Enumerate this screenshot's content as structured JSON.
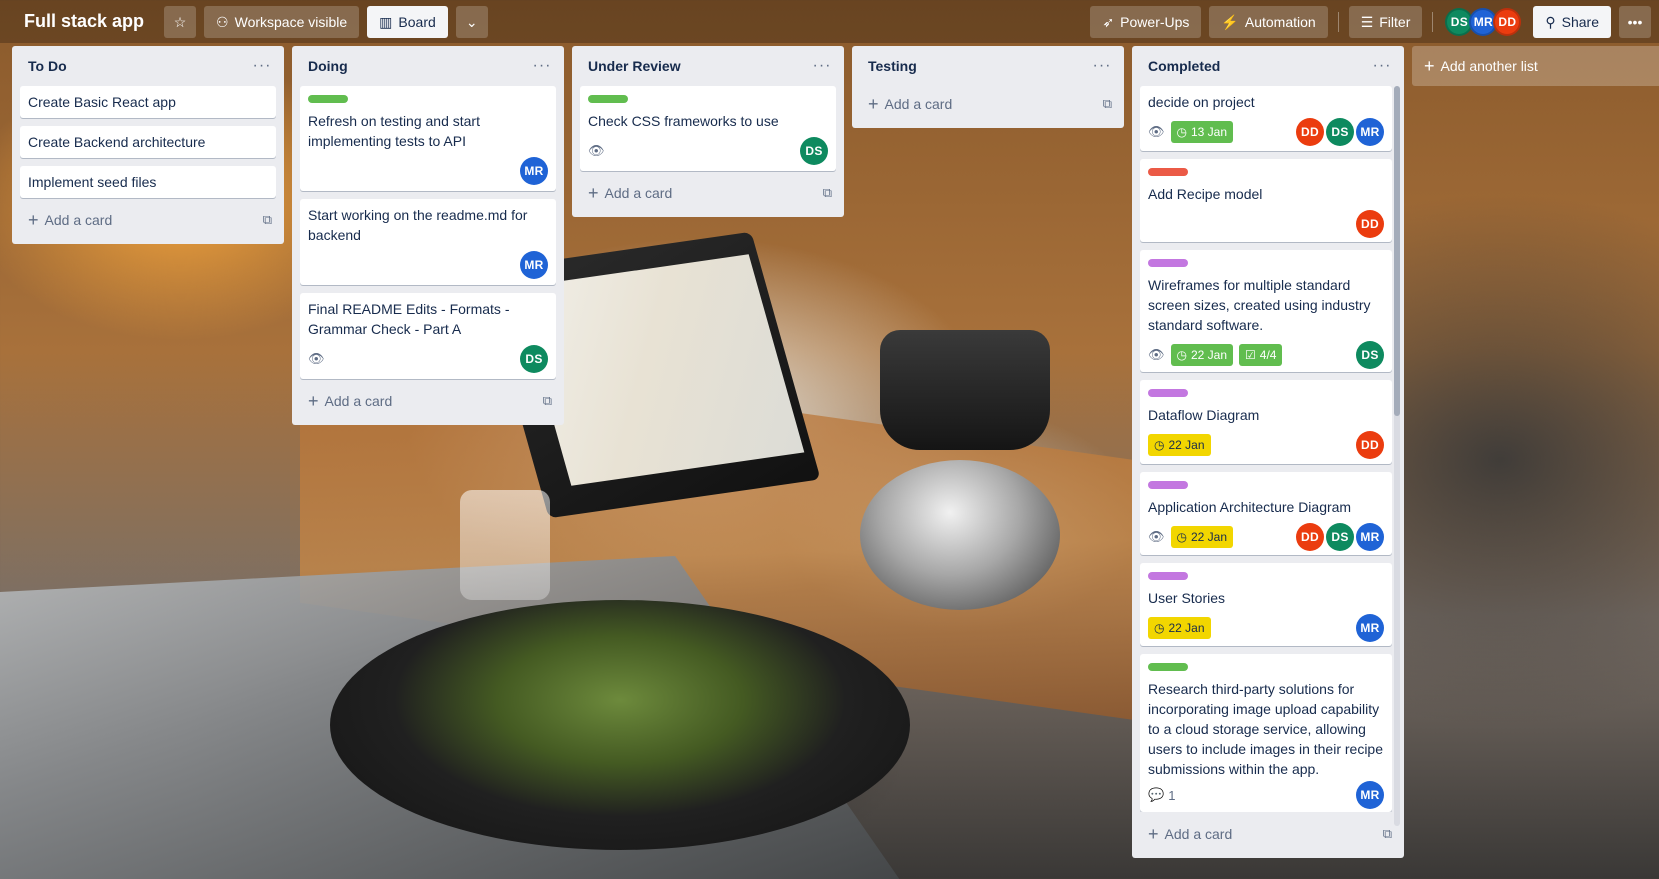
{
  "board": {
    "title": "Full stack app",
    "visibility_label": "Workspace visible",
    "view_label": "Board",
    "powerups_label": "Power-Ups",
    "automation_label": "Automation",
    "filter_label": "Filter",
    "share_label": "Share",
    "members": [
      "DS",
      "MR",
      "DD"
    ]
  },
  "common": {
    "add_card_label": "Add a card",
    "add_list_label": "Add another list",
    "list_menu_glyph": "···"
  },
  "lists": [
    {
      "title": "To Do",
      "cards": [
        {
          "title": "Create Basic React app"
        },
        {
          "title": "Create Backend architecture"
        },
        {
          "title": "Implement seed files"
        }
      ]
    },
    {
      "title": "Doing",
      "cards": [
        {
          "title": "Refresh on testing and start implementing tests to API",
          "label_color": "#61bd4f",
          "members": [
            "MR"
          ]
        },
        {
          "title": "Start working on the readme.md for backend",
          "members": [
            "MR"
          ]
        },
        {
          "title": "Final README Edits - Formats - Grammar Check - Part A",
          "watch": true,
          "members": [
            "DS"
          ]
        }
      ]
    },
    {
      "title": "Under Review",
      "cards": [
        {
          "title": "Check CSS frameworks to use",
          "label_color": "#61bd4f",
          "watch": true,
          "members": [
            "DS"
          ]
        }
      ]
    },
    {
      "title": "Testing",
      "cards": []
    },
    {
      "title": "Completed",
      "cards": [
        {
          "title": "decide on project",
          "watch": true,
          "date": "13 Jan",
          "date_style": "green",
          "members": [
            "DD",
            "DS",
            "MR"
          ]
        },
        {
          "title": "Add Recipe model",
          "label_color": "#eb5a46",
          "members": [
            "DD"
          ]
        },
        {
          "title": "Wireframes for multiple standard screen sizes, created using industry standard software.",
          "label_color": "#c377e0",
          "watch": true,
          "date": "22 Jan",
          "date_style": "green",
          "checklist": "4/4",
          "members": [
            "DS"
          ]
        },
        {
          "title": "Dataflow Diagram",
          "label_color": "#c377e0",
          "date": "22 Jan",
          "date_style": "yellow",
          "members": [
            "DD"
          ]
        },
        {
          "title": "Application Architecture Diagram",
          "label_color": "#c377e0",
          "watch": true,
          "date": "22 Jan",
          "date_style": "yellow",
          "members": [
            "DD",
            "DS",
            "MR"
          ]
        },
        {
          "title": "User Stories",
          "label_color": "#c377e0",
          "date": "22 Jan",
          "date_style": "yellow",
          "members": [
            "MR"
          ]
        },
        {
          "title": "Research third-party solutions for incorporating image upload capability to a cloud storage service, allowing users to include images in their recipe submissions within the app.",
          "label_color": "#61bd4f",
          "comments": "1",
          "members": [
            "MR"
          ]
        }
      ]
    }
  ]
}
